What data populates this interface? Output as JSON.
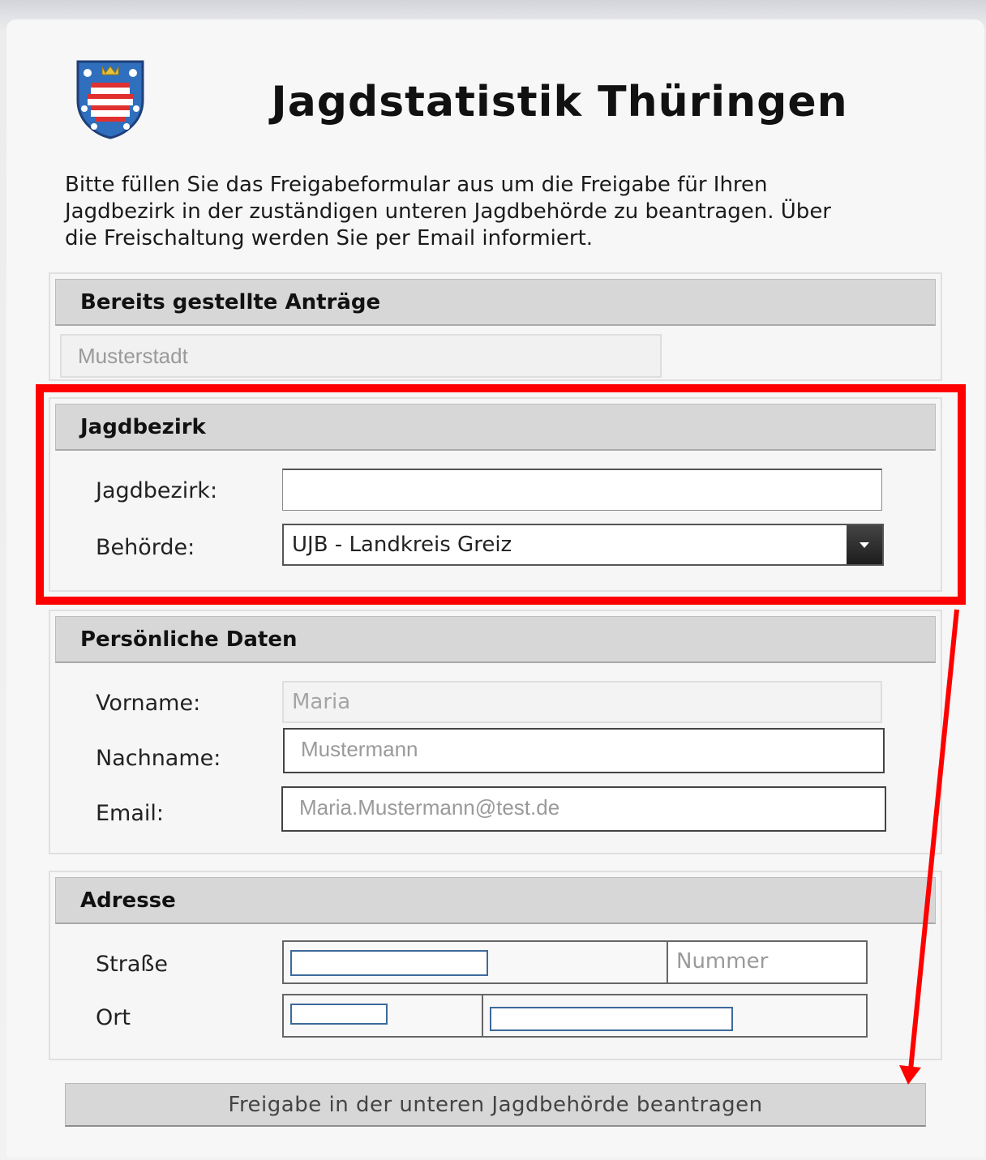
{
  "header": {
    "logo": "thueringen-coat-of-arms",
    "title": "Jagdstatistik Thüringen",
    "intro_line1": "Bitte füllen Sie das Freigabeformular aus um die Freigabe für Ihren",
    "intro_line2": "Jagdbezirk in der zuständigen unteren Jagdbehörde zu beantragen. Über",
    "intro_line3": "die Freischaltung werden Sie per Email informiert."
  },
  "antraege": {
    "heading": "Bereits gestellte Anträge",
    "value": "Musterstadt"
  },
  "jagdbezirk": {
    "heading": "Jagdbezirk",
    "bezirk_label": "Jagdbezirk:",
    "bezirk_value": "",
    "behoerde_label": "Behörde:",
    "behoerde_value": "UJB - Landkreis Greiz"
  },
  "personal": {
    "heading": "Persönliche Daten",
    "vorname_label": "Vorname:",
    "vorname_value": "Maria",
    "nachname_label": "Nachname:",
    "nachname_value": "Mustermann",
    "email_label": "Email:",
    "email_value": "Maria.Mustermann@test.de"
  },
  "address": {
    "heading": "Adresse",
    "strasse_label": "Straße",
    "nummer_placeholder": "Nummer",
    "ort_label": "Ort"
  },
  "submit_label": "Freigabe in der unteren Jagdbehörde beantragen",
  "colors": {
    "annotation": "#ff0000",
    "section_header": "#d7d7d7",
    "input_focus_border": "#3d6a9b"
  }
}
